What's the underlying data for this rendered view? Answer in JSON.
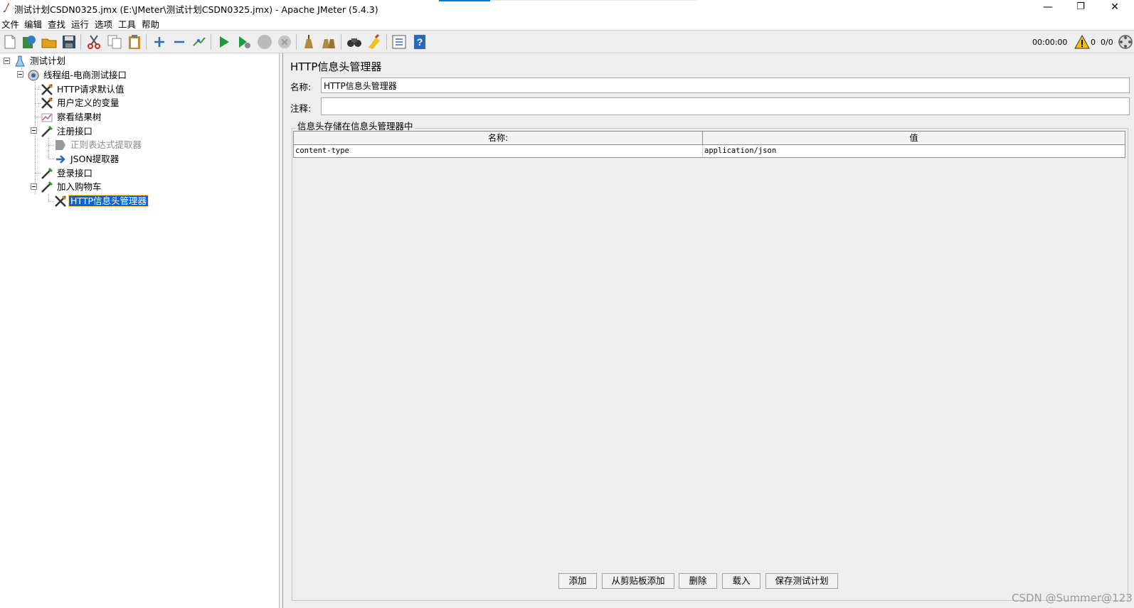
{
  "window": {
    "title": "测试计划CSDN0325.jmx (E:\\JMeter\\测试计划CSDN0325.jmx) - Apache JMeter (5.4.3)",
    "minimize_glyph": "—",
    "restore_glyph": "❐",
    "close_glyph": "✕"
  },
  "menu": [
    "文件",
    "编辑",
    "查找",
    "运行",
    "选项",
    "工具",
    "帮助"
  ],
  "toolbar": {
    "icons": [
      "new-icon",
      "templates-icon",
      "open-icon",
      "save-icon",
      "cut-icon",
      "copy-icon",
      "paste-icon",
      "expand-icon",
      "collapse-icon",
      "toggle-icon",
      "start-icon",
      "start-no-pause-icon",
      "stop-icon",
      "shutdown-icon",
      "clear-icon",
      "clear-all-icon",
      "search-icon",
      "reset-search-icon",
      "function-helper-icon",
      "help-icon"
    ],
    "timer": "00:00:00",
    "warning_count": "0",
    "thread_count": "0/0"
  },
  "tree": {
    "nodes": [
      {
        "label": "测试计划",
        "icon": "test-plan-icon"
      },
      {
        "label": "线程组-电商测试接口",
        "icon": "thread-group-icon"
      },
      {
        "label": "HTTP请求默认值",
        "icon": "config-element-icon"
      },
      {
        "label": "用户定义的变量",
        "icon": "config-element-icon"
      },
      {
        "label": "察看结果树",
        "icon": "listener-icon"
      },
      {
        "label": "注册接口",
        "icon": "sampler-icon"
      },
      {
        "label": "正则表达式提取器",
        "icon": "post-processor-icon"
      },
      {
        "label": "JSON提取器",
        "icon": "post-processor-icon"
      },
      {
        "label": "登录接口",
        "icon": "sampler-icon"
      },
      {
        "label": "加入购物车",
        "icon": "sampler-icon"
      },
      {
        "label": "HTTP信息头管理器",
        "icon": "config-element-icon"
      }
    ]
  },
  "panel": {
    "title": "HTTP信息头管理器",
    "name_label": "名称:",
    "name_value": "HTTP信息头管理器",
    "comment_label": "注释:",
    "comment_value": "",
    "group_title": "信息头存储在信息头管理器中",
    "columns": [
      "名称:",
      "值"
    ],
    "rows": [
      {
        "name": "content-type",
        "value": "application/json"
      }
    ],
    "buttons": {
      "add": "添加",
      "add_from_clipboard": "从剪贴板添加",
      "delete": "删除",
      "load": "载入",
      "save_test_plan": "保存测试计划"
    }
  },
  "watermark": "CSDN @Summer@123"
}
